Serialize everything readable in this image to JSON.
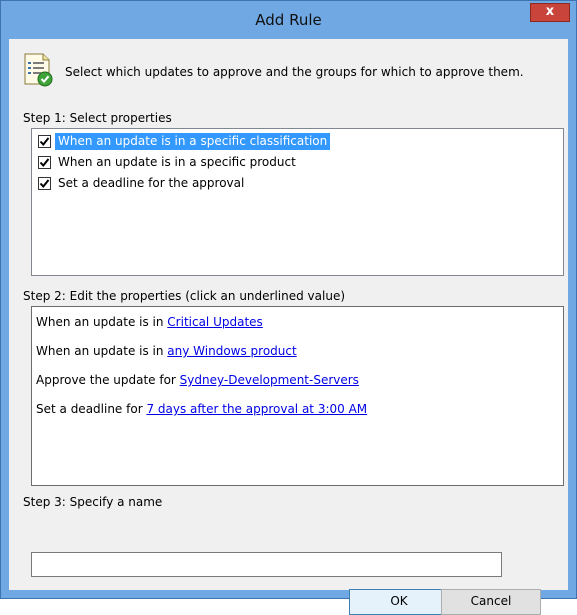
{
  "window": {
    "title": "Add Rule",
    "close_glyph": "x"
  },
  "header": {
    "icon": "rule-approve-icon",
    "instruction": "Select which updates to approve and the groups for which to approve them."
  },
  "step1": {
    "label": "Step 1: Select properties",
    "items": [
      {
        "label": "When an update is in a specific classification",
        "checked": true,
        "selected": true
      },
      {
        "label": "When an update is in a specific product",
        "checked": true,
        "selected": false
      },
      {
        "label": "Set a deadline for the approval",
        "checked": true,
        "selected": false
      }
    ]
  },
  "step2": {
    "label": "Step 2: Edit the properties (click an underlined value)",
    "lines": [
      {
        "prefix": "When an update is in ",
        "link": "Critical Updates"
      },
      {
        "prefix": "When an update is in ",
        "link": "any Windows product"
      },
      {
        "prefix": "Approve the update for ",
        "link": "Sydney-Development-Servers"
      },
      {
        "prefix": "Set a deadline for ",
        "link": "7 days after the approval at 3:00 AM"
      }
    ]
  },
  "step3": {
    "label": "Step 3: Specify a name",
    "name_value": ""
  },
  "buttons": {
    "ok": "OK",
    "cancel": "Cancel"
  },
  "colors": {
    "title_bar": "#6fa8e3",
    "close_button": "#c9453b",
    "selection": "#3399ff",
    "link": "#0000e6"
  }
}
